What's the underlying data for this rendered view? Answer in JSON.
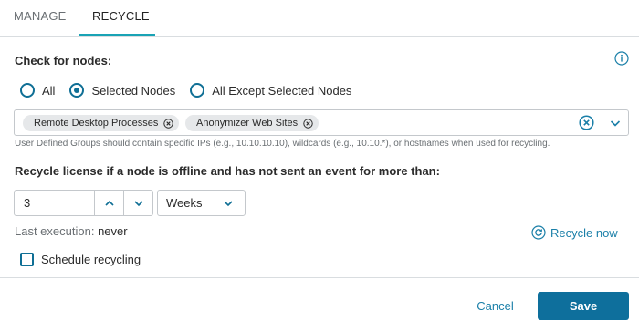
{
  "tabs": [
    {
      "label": "MANAGE",
      "active": false
    },
    {
      "label": "RECYCLE",
      "active": true
    }
  ],
  "check_nodes": {
    "title": "Check for nodes:",
    "info_icon": "info-icon",
    "options": [
      {
        "label": "All",
        "selected": false
      },
      {
        "label": "Selected Nodes",
        "selected": true
      },
      {
        "label": "All Except Selected Nodes",
        "selected": false
      }
    ]
  },
  "selected_tags": [
    "Remote Desktop Processes",
    "Anonymizer Web Sites"
  ],
  "hint": "User Defined Groups should contain specific IPs (e.g., 10.10.10.10), wildcards (e.g., 10.10.*), or hostnames when used for recycling.",
  "recycle_license": {
    "title": "Recycle license if a node is offline and has not sent an event for more than:",
    "amount": "3",
    "unit": "Weeks"
  },
  "last_execution": {
    "label": "Last execution:",
    "value": "never"
  },
  "recycle_now_label": "Recycle now",
  "schedule_recycling": {
    "label": "Schedule recycling",
    "checked": false
  },
  "footer": {
    "cancel_label": "Cancel",
    "save_label": "Save"
  },
  "colors": {
    "accent": "#1aa3b5",
    "primary": "#0e6f9c",
    "link": "#1a7fa8"
  }
}
